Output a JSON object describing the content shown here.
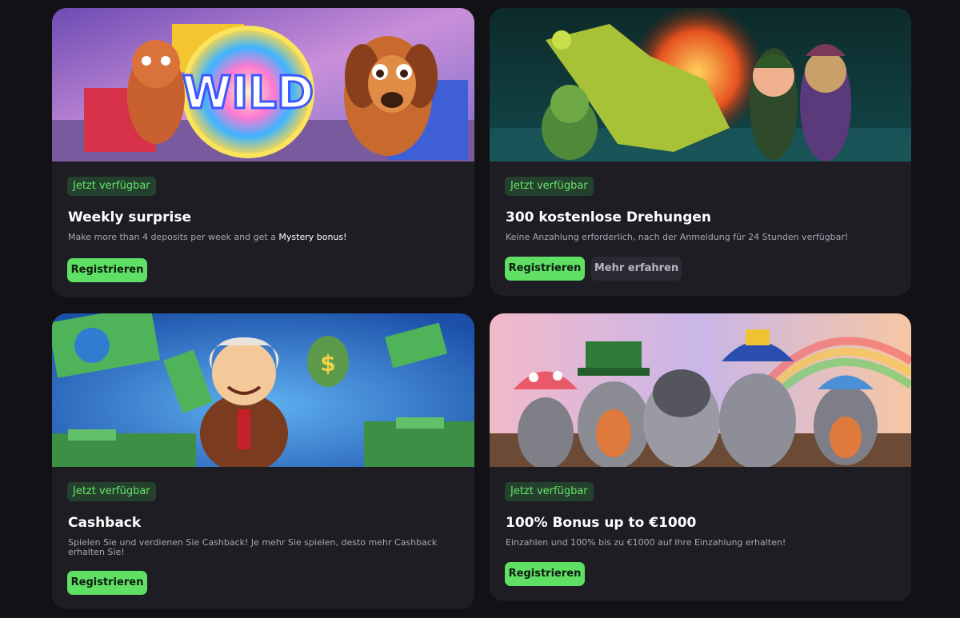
{
  "cards": [
    {
      "badge": "Jetzt verfügbar",
      "title": "Weekly surprise",
      "description_prefix": "Make more than 4 deposits per week and get a ",
      "description_highlight": "Mystery bonus!",
      "primary_button": "Registrieren",
      "banner": {
        "art": "wild-slot-characters",
        "text": "WILD"
      }
    },
    {
      "badge": "Jetzt verfügbar",
      "title": "300 kostenlose Drehungen",
      "description": "Keine Anzahlung erforderlich, nach der Anmeldung für 24 Stunden verfügbar!",
      "primary_button": "Registrieren",
      "secondary_button": "Mehr erfahren",
      "banner": {
        "art": "dragon-adventurers"
      }
    },
    {
      "badge": "Jetzt verfügbar",
      "title": "Cashback",
      "description": "Spielen Sie und verdienen Sie Cashback! Je mehr Sie spielen, desto mehr Cashback erhalten Sie!",
      "primary_button": "Registrieren",
      "banner": {
        "art": "money-rain-character",
        "text": "$"
      }
    },
    {
      "badge": "Jetzt verfügbar",
      "title": "100% Bonus up to €1000",
      "description": "Einzahlen und 100% bis zu €1000 auf Ihre Einzahlung erhalten!",
      "primary_button": "Registrieren",
      "banner": {
        "art": "raccoon-pirates"
      }
    }
  ],
  "colors": {
    "page_background": "#121216",
    "card_background": "#1d1d23",
    "badge_background": "#23412c",
    "badge_text": "#67e36b",
    "primary_button": "#5fe065",
    "secondary_button": "#2a2a33",
    "description_text": "#a7a7b4"
  }
}
